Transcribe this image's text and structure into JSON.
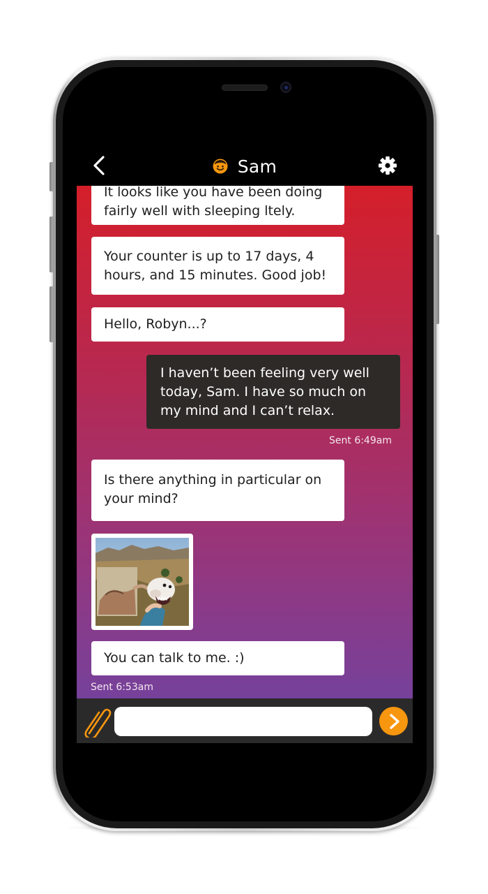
{
  "app": {
    "contact_name": "Sam"
  },
  "header": {
    "back_icon": "chevron-left-icon",
    "avatar_icon": "smiley-icon",
    "settings_icon": "gear-icon"
  },
  "messages": [
    {
      "sender": "bot",
      "lines": [
        "It looks like you have been doing",
        "fairly well with sleeping ltely."
      ]
    },
    {
      "sender": "bot",
      "lines": [
        "Your counter is up to 17 days, 4",
        "hours, and 15 minutes. Good job!"
      ]
    },
    {
      "sender": "bot",
      "lines": [
        "Hello, Robyn...?"
      ]
    },
    {
      "sender": "user",
      "lines": [
        "I haven’t been feeling very well",
        "today, Sam. I have so much on",
        "my mind and I can’t relax."
      ],
      "status": "Sent 6:49am"
    },
    {
      "sender": "bot",
      "lines": [
        "Is there anything in particular on",
        "your mind?"
      ]
    },
    {
      "sender": "bot",
      "type": "image"
    },
    {
      "sender": "bot",
      "lines": [
        "You can talk to me. :)"
      ],
      "status": "Sent 6:53am"
    }
  ],
  "composer": {
    "value": "",
    "placeholder": "",
    "attach_icon": "paperclip-icon",
    "send_icon": "chevron-right-icon"
  },
  "colors": {
    "gradient_top": "#d41f2a",
    "gradient_bottom": "#76419b",
    "user_bubble": "#2d2a27",
    "accent": "#f7960f"
  }
}
